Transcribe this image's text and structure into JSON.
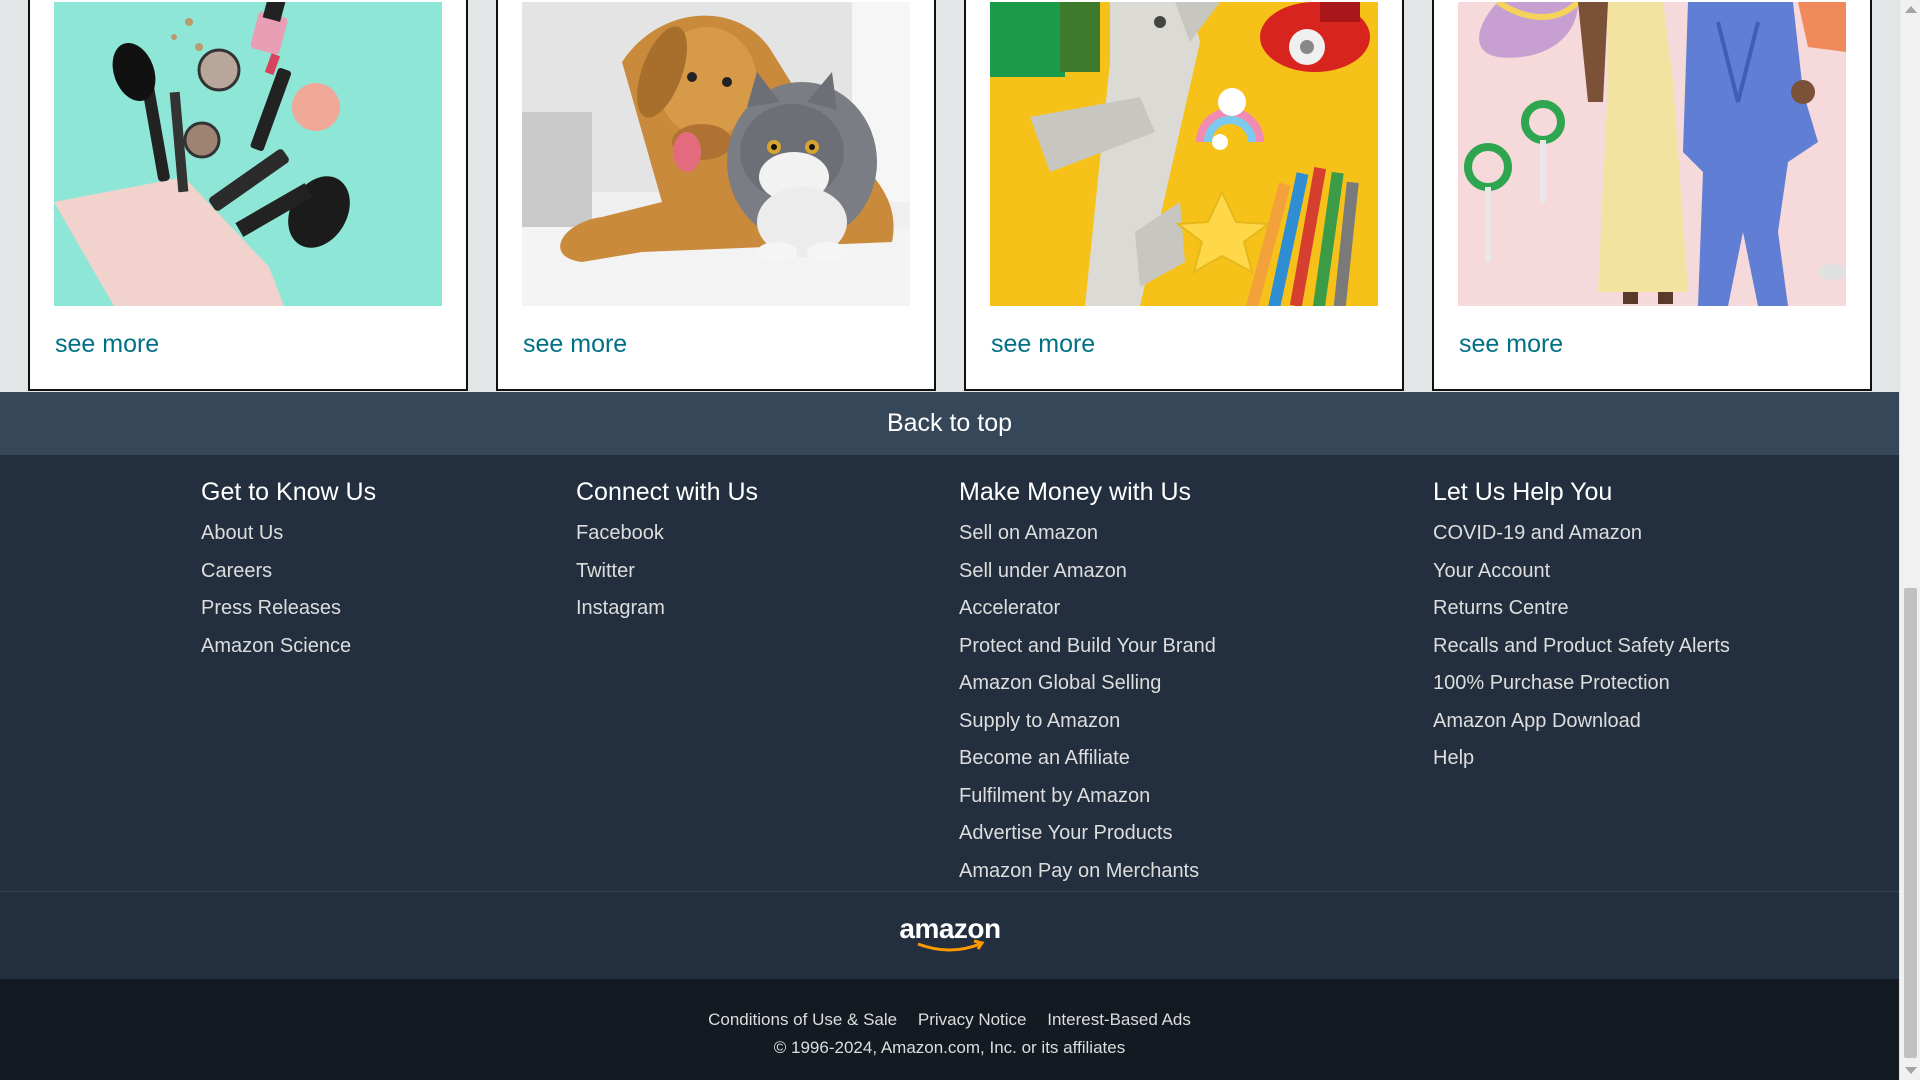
{
  "cards": [
    {
      "see_more": "see more",
      "image": "beauty-products-image"
    },
    {
      "see_more": "see more",
      "image": "dog-and-cat-image"
    },
    {
      "see_more": "see more",
      "image": "toys-image"
    },
    {
      "see_more": "see more",
      "image": "fashion-image"
    }
  ],
  "back_to_top": "Back to top",
  "footer": {
    "columns": [
      {
        "title": "Get to Know Us",
        "links": [
          "About Us",
          "Careers",
          "Press Releases",
          "Amazon Science"
        ]
      },
      {
        "title": "Connect with Us",
        "links": [
          "Facebook",
          "Twitter",
          "Instagram"
        ]
      },
      {
        "title": "Make Money with Us",
        "links": [
          "Sell on Amazon",
          "Sell under Amazon",
          "Accelerator",
          "Protect and Build Your Brand",
          "Amazon Global Selling",
          "Supply to Amazon",
          "Become an Affiliate",
          "Fulfilment by Amazon",
          "Advertise Your Products",
          "Amazon Pay on Merchants"
        ]
      },
      {
        "title": "Let Us Help You",
        "links": [
          "COVID-19 and Amazon",
          "Your Account",
          "Returns Centre",
          "Recalls and Product Safety Alerts",
          "100% Purchase Protection",
          "Amazon App Download",
          "Help"
        ]
      }
    ],
    "logo": "amazon"
  },
  "legal": {
    "links": [
      "Conditions of Use & Sale",
      "Privacy Notice",
      "Interest-Based Ads"
    ],
    "copyright": "© 1996-2024, Amazon.com, Inc. or its affiliates"
  },
  "colors": {
    "link": "#007185",
    "back_to_top_bg": "#37475a",
    "footer_bg": "#232f3e",
    "legal_bg": "#131a22",
    "logo_smile": "#ff9900"
  }
}
